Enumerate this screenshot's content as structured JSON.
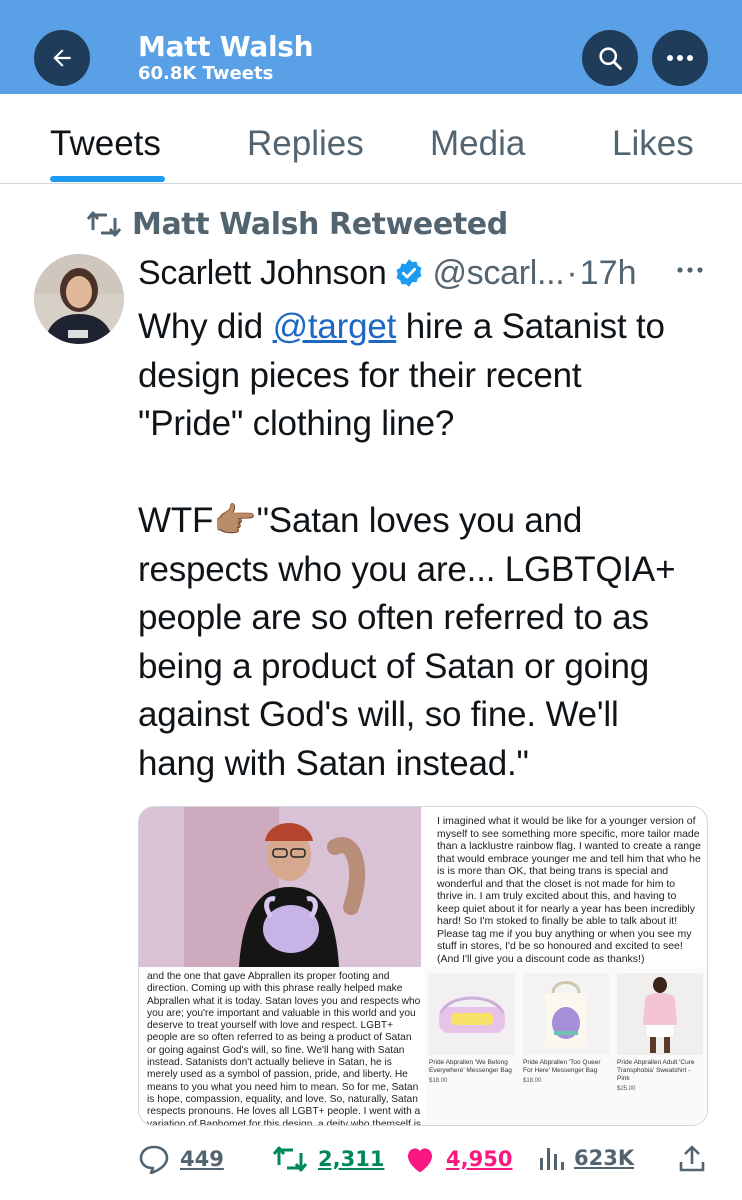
{
  "header": {
    "title": "Matt Walsh",
    "subtitle": "60.8K Tweets"
  },
  "tabs": [
    {
      "label": "Tweets",
      "active": true
    },
    {
      "label": "Replies",
      "active": false
    },
    {
      "label": "Media",
      "active": false
    },
    {
      "label": "Likes",
      "active": false
    }
  ],
  "retweet": {
    "label": "Matt Walsh Retweeted"
  },
  "tweet": {
    "author_name": "Scarlett Johnson",
    "handle": "@scarl...",
    "separator": "·",
    "time": "17h",
    "text_lines": {
      "l1_pre": "Why did ",
      "l1_mention": "@target",
      "l1_post": " hire a Satanist to",
      "l2": "design pieces for their recent",
      "l3": "\"Pride\" clothing line?",
      "l4": "WTF👉🏽\"Satan loves you and",
      "l5": "respects who you are... LGBTQIA+",
      "l6": "people are so often referred to as",
      "l7": "being a product of Satan or going",
      "l8": "against God's will, so fine. We'll",
      "l9": "hang with Satan instead.\""
    },
    "media": {
      "right_paragraph": "I imagined what it would be like for a younger version of myself to see something more specific, more tailor made than a lacklustre rainbow flag. I wanted to create a range that would embrace younger me and tell him that who he is is more than OK, that being trans is special and wonderful and that the closet is not made for him to thrive in. I am truly excited about this, and having to keep quiet about it for nearly a year has been incredibly hard! So I'm stoked to finally be able to talk about it! Please tag me if you buy anything or when you see my stuff in stores, I'd be so honoured and excited to see! (And I'll give you a discount code as thanks!)",
      "left_paragraph": "and the one that gave Abprallen its proper footing and direction. Coming up with this phrase really helped make Abprallen what it is today. Satan loves you and respects who you are; you're important and valuable in this world and you deserve to treat yourself with love and respect. LGBT+ people are so often referred to as being a product of Satan or going against God's will, so fine. We'll hang with Satan instead. Satanists don't actually believe in Satan, he is merely used as a symbol of passion, pride, and liberty. He means to you what you need him to mean. So for me, Satan is hope, compassion, equality, and love. So, naturally, Satan respects pronouns. He loves all LGBT+ people. I went with a variation of Baphomet for this design, a deity who themself is a mixture of genders, beings, ideas",
      "products": [
        {
          "title": "Pride Abprallen 'We Belong Everywhere' Messenger Bag",
          "price": "$18.00"
        },
        {
          "title": "Pride Abprallen 'Too Queer For Here' Messenger Bag",
          "price": "$18.00"
        },
        {
          "title": "Pride Abprallen Adult 'Cure Transphobia' Sweatshirt - Pink",
          "price": "$25.00"
        }
      ]
    },
    "stats": {
      "replies": "449",
      "retweets": "2,311",
      "likes": "4,950",
      "views": "623K"
    }
  },
  "colors": {
    "header_bg": "#5aa0e6",
    "button_bg": "#1f3c5a",
    "accent": "#1d9bf0",
    "retweet_green": "#00875a",
    "like_pink": "#f91880"
  }
}
